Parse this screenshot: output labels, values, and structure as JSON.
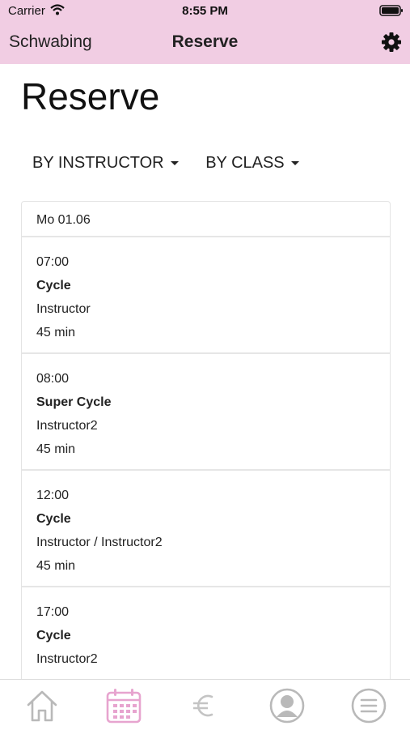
{
  "status_bar": {
    "carrier": "Carrier",
    "time": "8:55 PM"
  },
  "nav": {
    "left_label": "Schwabing",
    "title": "Reserve"
  },
  "page": {
    "title": "Reserve"
  },
  "filters": {
    "by_instructor": "BY INSTRUCTOR",
    "by_class": "BY CLASS"
  },
  "schedule": {
    "day": "Mo 01.06",
    "classes": [
      {
        "time": "07:00",
        "name": "Cycle",
        "instructor": "Instructor",
        "duration": "45 min"
      },
      {
        "time": "08:00",
        "name": "Super Cycle",
        "instructor": "Instructor2",
        "duration": "45 min"
      },
      {
        "time": "12:00",
        "name": "Cycle",
        "instructor": "Instructor / Instructor2",
        "duration": "45 min"
      },
      {
        "time": "17:00",
        "name": "Cycle",
        "instructor": "Instructor2",
        "duration": ""
      }
    ]
  },
  "tabbar": {
    "items": [
      {
        "icon": "home-icon",
        "active": false
      },
      {
        "icon": "calendar-icon",
        "active": true
      },
      {
        "icon": "euro-icon",
        "active": false
      },
      {
        "icon": "profile-icon",
        "active": false
      },
      {
        "icon": "menu-icon",
        "active": false
      }
    ]
  },
  "colors": {
    "header_bg": "#f1cde3",
    "active_tab": "#e7a4cf",
    "inactive_tab": "#b9b9b9"
  }
}
